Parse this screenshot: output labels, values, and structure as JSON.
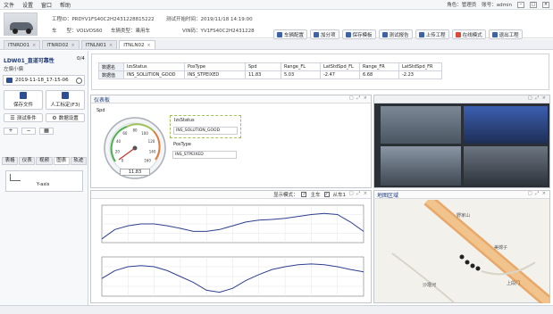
{
  "menu": {
    "items": [
      "文件",
      "设置",
      "窗口",
      "帮助"
    ],
    "role_label": "角色：管理员",
    "user_label": "账号：admin"
  },
  "header": {
    "project_label": "工程ID：PRDYV1FS40C2H2431228815222",
    "start_time_label": "测试开始时间：2019/11/18 14:19:00",
    "vehicle_label": "车　　型：VOLVOS60",
    "vehicle_type_label": "车辆类型：乘用车",
    "vin_label": "VIN码：YV1FS40C2H2431228",
    "toolbar": [
      "车辆配置",
      "加分项",
      "保存模板",
      "测试报告",
      "上传工程",
      "在线模式",
      "退出工程"
    ]
  },
  "tabs": [
    "ITNRD01",
    "ITNRD02",
    "ITNLN01",
    "ITNLN02"
  ],
  "sidebar": {
    "case_title": "LDW01_直道可靠性",
    "case_progress": "0/4",
    "case_subtitle": "左偏小偏",
    "record_time": "2019-11-18_17-15-06",
    "save_file_label": "保存文件",
    "manual_mark_label": "人工标定(F3)",
    "test_condition_label": "测试条件",
    "data_settings_label": "数据设置",
    "view_tabs": [
      "表格",
      "仪表",
      "视频",
      "图表",
      "轨迹"
    ],
    "chart_item_label": "Y-axis"
  },
  "datatable": {
    "headers": [
      "数据名",
      "IzsStatus",
      "PosType",
      "Spd",
      "Range_FL",
      "LatStdSpd_FL",
      "Range_FR",
      "LatStdSpd_FR"
    ],
    "row_label": "数据值",
    "values": [
      "INS_SOLUTION_GOOD",
      "INS_STPEIXED",
      "11.83",
      "5.03",
      "-2.47",
      "6.68",
      "-2.23"
    ]
  },
  "gauge_panel": {
    "title": "仪表板",
    "gauge_label": "Spd",
    "gauge_value": "11.83",
    "gauge_ticks": [
      "0",
      "20",
      "40",
      "60",
      "80",
      "100",
      "120",
      "140",
      "160"
    ],
    "field1_label": "IzsStatus",
    "field1_value": "INS_SOLUTION_GOOD",
    "field2_label": "PosType",
    "field2_value": "INS_STPEIXED"
  },
  "video_panel": {
    "controls": "□ ⤢ ×"
  },
  "chart_panel": {
    "display_label": "显示模式：",
    "opt1_label": "主车",
    "opt2_label": "从车1",
    "controls": "□ ⤢ ×"
  },
  "map_panel": {
    "title": "地图区域",
    "labels": [
      "野家山",
      "美嫦子",
      "沙堰河",
      "上段门"
    ],
    "controls": "□ ⤢ ×"
  },
  "chart_data": [
    {
      "type": "line",
      "title": "",
      "xlabel": "",
      "ylabel": "",
      "grid": true,
      "series": [
        {
          "name": "",
          "x": [
            0,
            1,
            2,
            3,
            4,
            5,
            6,
            7,
            8,
            9,
            10,
            11,
            12,
            13,
            14,
            15,
            16,
            17,
            18,
            19,
            20
          ],
          "values": [
            0.1,
            0.35,
            0.45,
            0.5,
            0.5,
            0.45,
            0.38,
            0.3,
            0.3,
            0.35,
            0.45,
            0.55,
            0.6,
            0.62,
            0.65,
            0.7,
            0.75,
            0.78,
            0.75,
            0.55,
            0.3
          ]
        }
      ]
    },
    {
      "type": "line",
      "title": "",
      "xlabel": "",
      "ylabel": "",
      "grid": true,
      "series": [
        {
          "name": "",
          "x": [
            0,
            1,
            2,
            3,
            4,
            5,
            6,
            7,
            8,
            9,
            10,
            11,
            12,
            13,
            14,
            15,
            16,
            17,
            18,
            19,
            20
          ],
          "values": [
            0.45,
            0.65,
            0.75,
            0.78,
            0.75,
            0.65,
            0.5,
            0.35,
            0.15,
            0.1,
            0.2,
            0.4,
            0.55,
            0.68,
            0.75,
            0.8,
            0.82,
            0.8,
            0.75,
            0.68,
            0.62
          ]
        }
      ]
    }
  ]
}
